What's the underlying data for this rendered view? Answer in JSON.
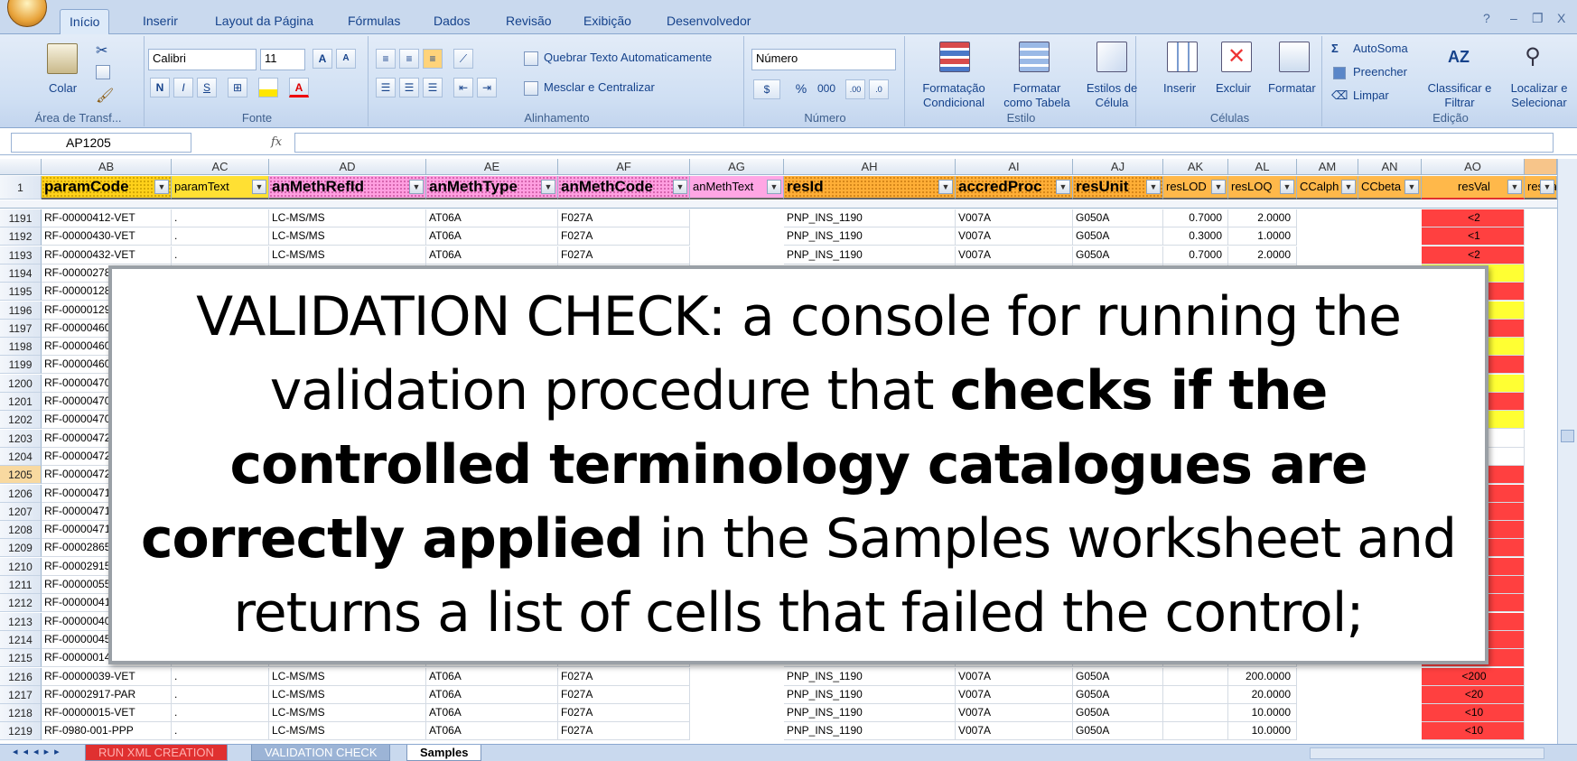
{
  "ribbon_tabs": [
    "Início",
    "Inserir",
    "Layout da Página",
    "Fórmulas",
    "Dados",
    "Revisão",
    "Exibição",
    "Desenvolvedor"
  ],
  "window_controls": [
    "?",
    "–",
    "❐",
    "X"
  ],
  "clipboard": {
    "paste": "Colar",
    "group": "Área de Transf..."
  },
  "font": {
    "name": "Calibri",
    "size": "11",
    "bold": "N",
    "italic": "I",
    "underline": "S",
    "group": "Fonte"
  },
  "alignment": {
    "wrap": "Quebrar Texto Automaticamente",
    "merge": "Mesclar e Centralizar",
    "group": "Alinhamento"
  },
  "number": {
    "format": "Número",
    "group": "Número",
    "percent": "%",
    "thousands": "000"
  },
  "styles": {
    "cond": "Formatação Condicional",
    "table": "Formatar como Tabela",
    "cell": "Estilos de Célula",
    "group": "Estilo"
  },
  "cells": {
    "insert": "Inserir",
    "delete": "Excluir",
    "format": "Formatar",
    "group": "Células"
  },
  "editing": {
    "autosum": "AutoSoma",
    "fill": "Preencher",
    "clear": "Limpar",
    "sort": "Classificar e Filtrar",
    "find": "Localizar e Selecionar",
    "group": "Edição"
  },
  "formula_bar": {
    "name_box": "AP1205",
    "fx": "fx"
  },
  "columns": [
    "AB",
    "AC",
    "AD",
    "AE",
    "AF",
    "AG",
    "AH",
    "AI",
    "AJ",
    "AK",
    "AL",
    "AM",
    "AN",
    "AO"
  ],
  "header_row": {
    "num": "1",
    "cells": [
      "paramCode",
      "paramText",
      "anMethRefId",
      "anMethType",
      "anMethCode",
      "anMethText",
      "resId",
      "accredProc",
      "resUnit",
      "resLOD",
      "resLOQ",
      "CCalph",
      "CCbeta",
      "resVal",
      "resVa"
    ]
  },
  "rows": [
    {
      "num": "1191",
      "code": "RF-00000412-VET",
      "ref": "LC-MS/MS",
      "type": "AT06A",
      "mcode": "F027A",
      "resid": "PNP_INS_1190",
      "accred": "V007A",
      "unit": "G050A",
      "lod": "0.7000",
      "loq": "2.0000",
      "val": "<2"
    },
    {
      "num": "1192",
      "code": "RF-00000430-VET",
      "ref": "LC-MS/MS",
      "type": "AT06A",
      "mcode": "F027A",
      "resid": "PNP_INS_1190",
      "accred": "V007A",
      "unit": "G050A",
      "lod": "0.3000",
      "loq": "1.0000",
      "val": "<1"
    },
    {
      "num": "1193",
      "code": "RF-00000432-VET",
      "ref": "LC-MS/MS",
      "type": "AT06A",
      "mcode": "F027A",
      "resid": "PNP_INS_1190",
      "accred": "V007A",
      "unit": "G050A",
      "lod": "0.7000",
      "loq": "2.0000",
      "val": "<2"
    },
    {
      "num": "1194",
      "code": "RF-00000278"
    },
    {
      "num": "1195",
      "code": "RF-00000128"
    },
    {
      "num": "1196",
      "code": "RF-00000129"
    },
    {
      "num": "1197",
      "code": "RF-00000460"
    },
    {
      "num": "1198",
      "code": "RF-00000460"
    },
    {
      "num": "1199",
      "code": "RF-00000460"
    },
    {
      "num": "1200",
      "code": "RF-00000470"
    },
    {
      "num": "1201",
      "code": "RF-00000470"
    },
    {
      "num": "1202",
      "code": "RF-00000470"
    },
    {
      "num": "1203",
      "code": "RF-00000472"
    },
    {
      "num": "1204",
      "code": "RF-00000472"
    },
    {
      "num": "1205",
      "code": "RF-00000472"
    },
    {
      "num": "1206",
      "code": "RF-00000471"
    },
    {
      "num": "1207",
      "code": "RF-00000471"
    },
    {
      "num": "1208",
      "code": "RF-00000471"
    },
    {
      "num": "1209",
      "code": "RF-00002865"
    },
    {
      "num": "1210",
      "code": "RF-00002915"
    },
    {
      "num": "1211",
      "code": "RF-00000055"
    },
    {
      "num": "1212",
      "code": "RF-00000041"
    },
    {
      "num": "1213",
      "code": "RF-00000040"
    },
    {
      "num": "1214",
      "code": "RF-00000045"
    },
    {
      "num": "1215",
      "code": "RF-00000014"
    },
    {
      "num": "1216",
      "code": "RF-00000039-VET",
      "ref": "LC-MS/MS",
      "type": "AT06A",
      "mcode": "F027A",
      "resid": "PNP_INS_1190",
      "accred": "V007A",
      "unit": "G050A",
      "lod": "",
      "loq": "200.0000",
      "val": "<200"
    },
    {
      "num": "1217",
      "code": "RF-00002917-PAR",
      "ref": "LC-MS/MS",
      "type": "AT06A",
      "mcode": "F027A",
      "resid": "PNP_INS_1190",
      "accred": "V007A",
      "unit": "G050A",
      "lod": "",
      "loq": "20.0000",
      "val": "<20"
    },
    {
      "num": "1218",
      "code": "RF-00000015-VET",
      "ref": "LC-MS/MS",
      "type": "AT06A",
      "mcode": "F027A",
      "resid": "PNP_INS_1190",
      "accred": "V007A",
      "unit": "G050A",
      "lod": "",
      "loq": "10.0000",
      "val": "<10"
    },
    {
      "num": "1219",
      "code": "RF-0980-001-PPP",
      "ref": "LC-MS/MS",
      "type": "AT06A",
      "mcode": "F027A",
      "resid": "PNP_INS_1190",
      "accred": "V007A",
      "unit": "G050A",
      "lod": "",
      "loq": "10.0000",
      "val": "<10"
    }
  ],
  "partial_values": {
    "r1194": "7",
    "r1196": "4"
  },
  "sheet_tabs": [
    "RUN XML CREATION",
    "VALIDATION CHECK",
    "Samples"
  ],
  "overlay": {
    "p1": "VALIDATION CHECK: a console for running the validation procedure that ",
    "bold1": "checks if the controlled terminology catalogues are correctly applied",
    "p2": " in the Samples worksheet and returns a list of cells that failed the control;"
  },
  "colors": {
    "red": "#ff4040",
    "yellow": "#ffff33",
    "ribbon": "#c9d9ee",
    "accent": "#15428b"
  }
}
